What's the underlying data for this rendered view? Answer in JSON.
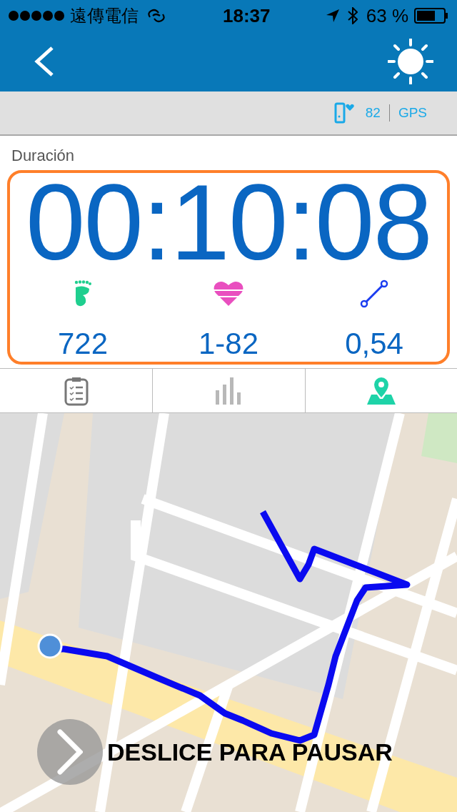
{
  "status_bar": {
    "carrier": "遠傳電信",
    "time": "18:37",
    "battery": "63 %"
  },
  "sensor_bar": {
    "heart_rate": "82",
    "gps": "GPS"
  },
  "duration": {
    "label": "Duración",
    "value": "00:10:08"
  },
  "stats": [
    {
      "kind": "steps",
      "value": "722",
      "color": "#1fcf8f"
    },
    {
      "kind": "heart",
      "value": "1-82",
      "color": "#e94fbf"
    },
    {
      "kind": "distance",
      "value": "0,54",
      "color": "#1a3cf0"
    }
  ],
  "tabs": [
    {
      "kind": "summary",
      "selected": false
    },
    {
      "kind": "chart",
      "selected": false
    },
    {
      "kind": "map",
      "selected": true
    }
  ],
  "map": {
    "kind": "picture",
    "slider_label": "DESLICE PARA PAUSAR"
  }
}
